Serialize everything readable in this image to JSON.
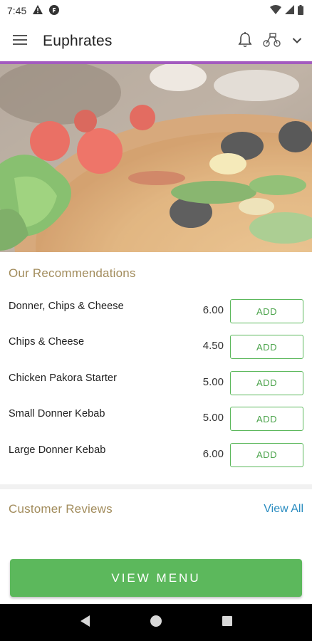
{
  "status_bar": {
    "time": "7:45"
  },
  "app_bar": {
    "title": "Euphrates"
  },
  "recommendations": {
    "title": "Our Recommendations",
    "add_label": "ADD",
    "items": [
      {
        "name": "Donner, Chips & Cheese",
        "price": "6.00"
      },
      {
        "name": "Chips & Cheese",
        "price": "4.50"
      },
      {
        "name": "Chicken Pakora Starter",
        "price": "5.00"
      },
      {
        "name": "Small Donner Kebab",
        "price": "5.00"
      },
      {
        "name": "Large Donner Kebab",
        "price": "6.00"
      }
    ]
  },
  "reviews": {
    "title": "Customer Reviews",
    "view_all": "View All"
  },
  "cta": {
    "label": "VIEW MENU"
  },
  "colors": {
    "accent_purple": "#a35bbf",
    "green": "#5cb85c",
    "gold": "#a28c5c",
    "link": "#2a8cc0"
  }
}
